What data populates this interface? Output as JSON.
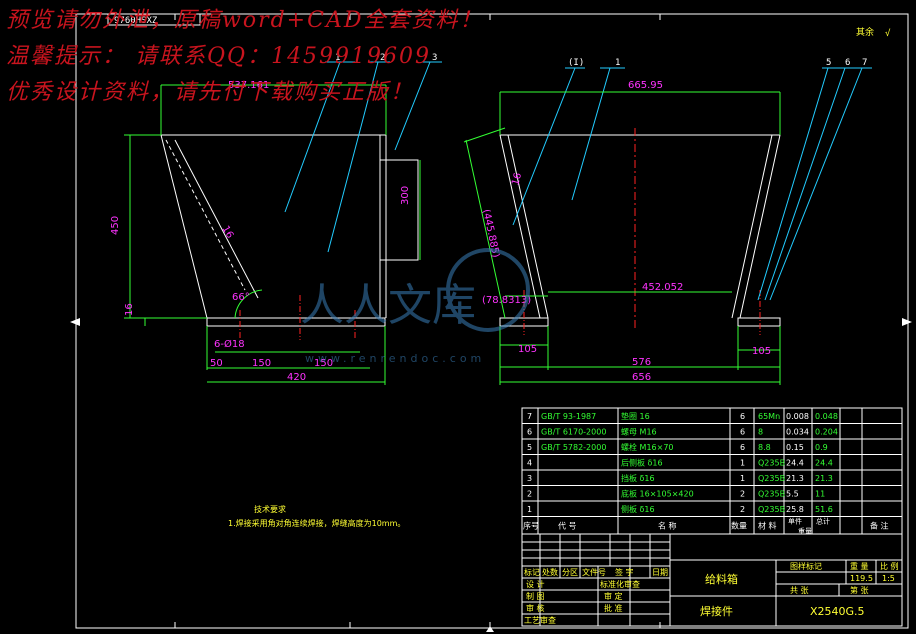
{
  "watermark": {
    "line1": "预览请勿外泄，原稿word+CAD全套资料！",
    "line2": "温馨提示：  请联系QQ：1459919609",
    "line3": "优秀设计资料，请先付下载购买正版！"
  },
  "colors": {
    "outline": "#ffffff",
    "dimension": "#33ff33",
    "dim_text": "#ff33ff",
    "leader": "#22ccff",
    "center": "#ff2222",
    "text_yellow": "#ffff33"
  },
  "corner_stamp": "9760HSXZ",
  "roughness": "其余",
  "left_view": {
    "top_width": "537.161",
    "height": "450",
    "inner_height": "300",
    "angle": "16",
    "base_angle": "66°",
    "plate_thick": "16",
    "holes": "6-Ø18",
    "dims_bottom": [
      "50",
      "150",
      "150"
    ],
    "overall": "420",
    "callouts": [
      "1",
      "2",
      "3"
    ]
  },
  "right_view": {
    "top_width": "665.95",
    "angle": "16",
    "slant": "(445.885)",
    "offset": "(78.8313)",
    "inner": "452.052",
    "left_margin": "105",
    "right_margin": "105",
    "bottom": "576",
    "overall": "656",
    "callouts": [
      "(I)",
      "1",
      "5",
      "6",
      "7"
    ]
  },
  "watermark_site": "www.renrendoc.com",
  "watermark_logo": "人人文库",
  "tech_req": {
    "title": "技术要求",
    "text": "1.焊接采用角对角连续焊接，焊缝高度为10mm。"
  },
  "bom": {
    "rows": [
      {
        "no": "7",
        "std": "GB/T 93-1987",
        "name": "垫圈 16",
        "qty": "6",
        "mat": "65Mn",
        "unit": "0.008",
        "total": "0.048"
      },
      {
        "no": "6",
        "std": "GB/T 6170-2000",
        "name": "螺母 M16",
        "qty": "6",
        "mat": "8",
        "unit": "0.034",
        "total": "0.204"
      },
      {
        "no": "5",
        "std": "GB/T 5782-2000",
        "name": "螺栓 M16×70",
        "qty": "6",
        "mat": "8.8",
        "unit": "0.15",
        "total": "0.9"
      },
      {
        "no": "4",
        "std": "",
        "name": "后侧板 δ16",
        "qty": "1",
        "mat": "Q235B",
        "unit": "24.4",
        "total": "24.4"
      },
      {
        "no": "3",
        "std": "",
        "name": "挡板 δ16",
        "qty": "1",
        "mat": "Q235B",
        "unit": "21.3",
        "total": "21.3"
      },
      {
        "no": "2",
        "std": "",
        "name": "底板 16×105×420",
        "qty": "2",
        "mat": "Q235B",
        "unit": "5.5",
        "total": "11"
      },
      {
        "no": "1",
        "std": "",
        "name": "侧板 δ16",
        "qty": "2",
        "mat": "Q235B",
        "unit": "25.8",
        "total": "51.6"
      }
    ],
    "header": {
      "no": "序号",
      "code": "代  号",
      "name": "名    称",
      "qty": "数量",
      "mat": "材  料",
      "unit": "单件",
      "total": "总计",
      "weight": "重量",
      "remark": "备 注"
    }
  },
  "title_block": {
    "part_name": "给料箱",
    "type": "焊接件",
    "drawing_no": "X2540G.5",
    "weight": "119.5",
    "scale": "1:5",
    "labels": {
      "stage": "图样标记",
      "weight": "重 量",
      "scale": "比 例",
      "sheets": "共    张",
      "sheet": "第    张",
      "rev": [
        "标记",
        "处数",
        "分区",
        "文件号",
        "签 字",
        "日期"
      ],
      "design": "设  计",
      "draw": "制  图",
      "check": "审  核",
      "process": "工艺审查",
      "standard": "标准化审查",
      "review": "审 定",
      "approve": "批 准"
    }
  }
}
